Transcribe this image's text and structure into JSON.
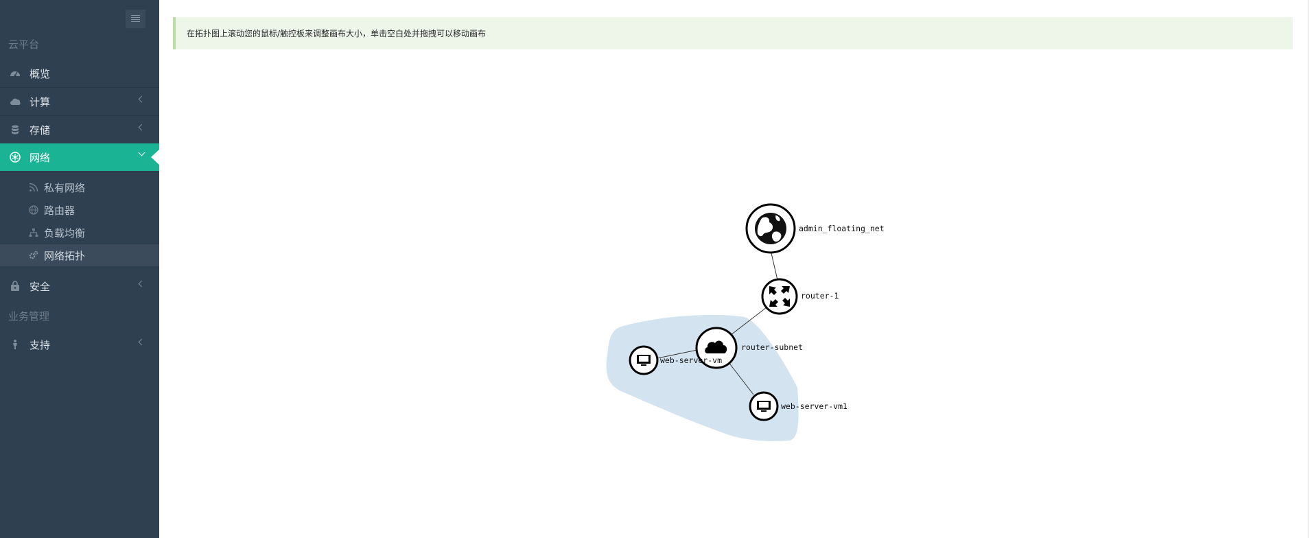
{
  "sidebar": {
    "section_cloud": "云平台",
    "section_business": "业务管理",
    "items": {
      "overview": "概览",
      "compute": "计算",
      "storage": "存储",
      "network": "网络",
      "security": "安全",
      "support": "支持"
    },
    "network_sub": {
      "private": "私有网络",
      "router": "路由器",
      "lb": "负载均衡",
      "topology": "网络拓扑"
    }
  },
  "notice": {
    "text": "在拓扑图上滚动您的鼠标/触控板来调整画布大小，单击空白处并拖拽可以移动画布"
  },
  "topology": {
    "nodes": {
      "external": "admin_floating_net",
      "router": "router-1",
      "subnet": "router-subnet",
      "vm1": "web-server-vm",
      "vm2": "web-server-vm1"
    },
    "colors": {
      "group": "#d3e3ef",
      "active": "#1ab394",
      "sidebar": "#2f4050"
    }
  }
}
